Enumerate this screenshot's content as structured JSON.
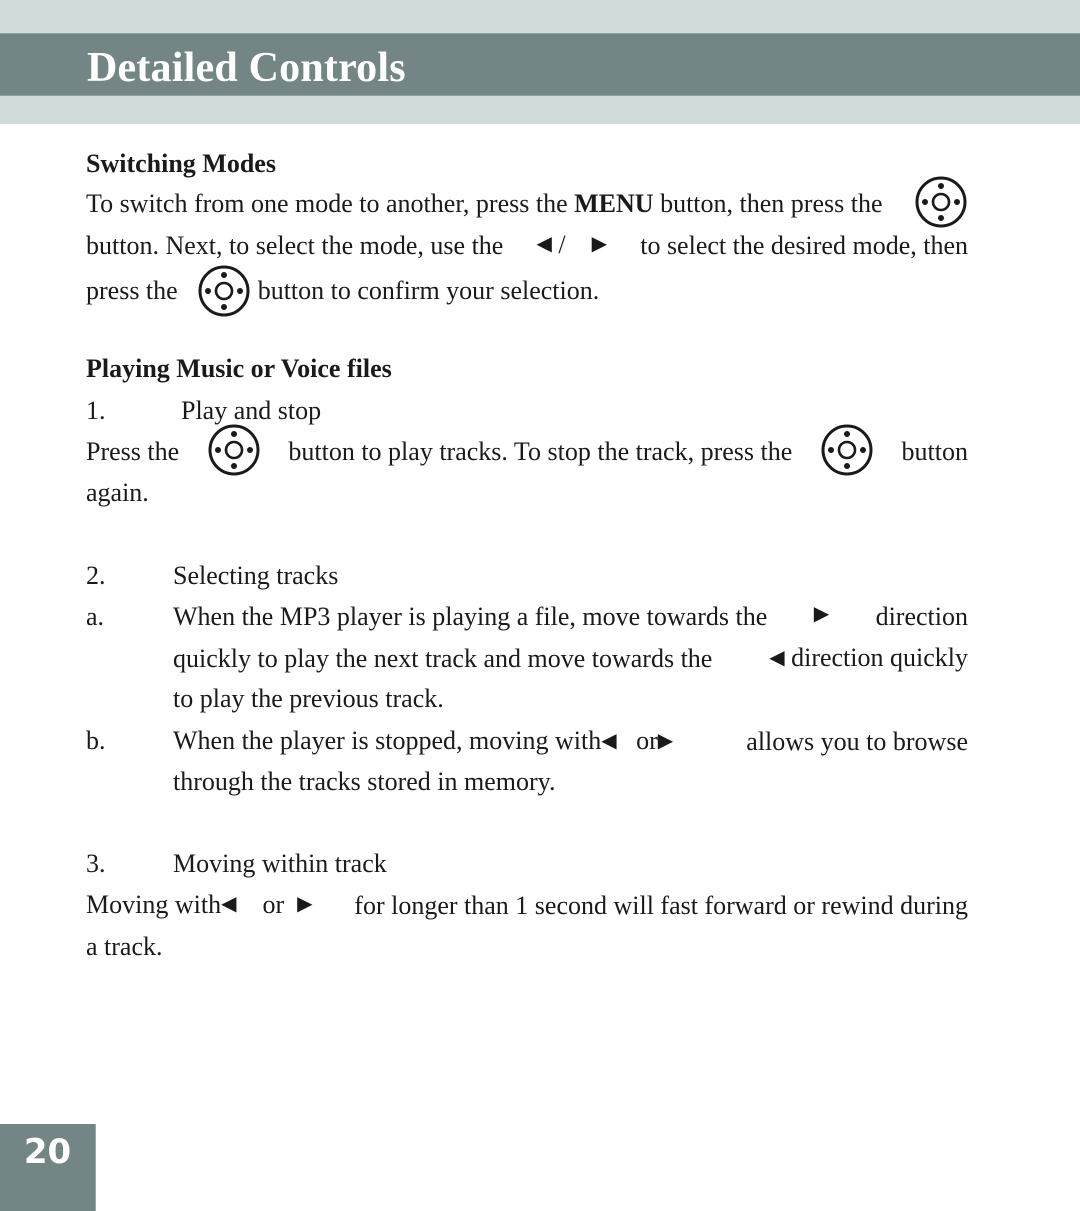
{
  "header": {
    "title": "Detailed Controls"
  },
  "icons": {
    "nav_button": "navigation-button-icon",
    "left": "◀",
    "right": "▶"
  },
  "sections": {
    "switching": {
      "heading": "Switching Modes",
      "l1_a": "To switch from one mode to another, press the",
      "l1_menu": "MENU",
      "l1_b": "button, then press the",
      "l2_a": "button. Next, to select the mode, use the",
      "l2_slash": "/",
      "l2_b": "to select the desired mode, then",
      "l3_a": "press the",
      "l3_b": "button to confirm your selection."
    },
    "playing": {
      "heading": "Playing Music or Voice files",
      "item1_num": "1.",
      "item1_title": "Play and stop",
      "p1_a": "Press the",
      "p1_b": "button to play tracks. To stop the track, press the",
      "p1_c": "button",
      "p1_d": "again.",
      "item2_num": "2.",
      "item2_title": "Selecting tracks",
      "a_label": "a.",
      "a_l1_a": "When the MP3 player is playing a file, move towards the",
      "a_l1_b": "direction",
      "a_l2_a": "quickly to play the next track and move towards the",
      "a_l2_b": "direction quickly",
      "a_l3": "to play the previous track.",
      "b_label": "b.",
      "b_l1_a": "When the player is stopped, moving with",
      "b_l1_or": "or",
      "b_l1_b": "allows you to browse",
      "b_l2": "through the tracks stored in memory.",
      "item3_num": "3.",
      "item3_title": "Moving within track",
      "m_l1_a": "Moving with",
      "m_l1_or": "or",
      "m_l1_b": "for longer than 1 second will fast forward or rewind during",
      "m_l2": "a track."
    }
  },
  "footer": {
    "page_number": "20"
  }
}
